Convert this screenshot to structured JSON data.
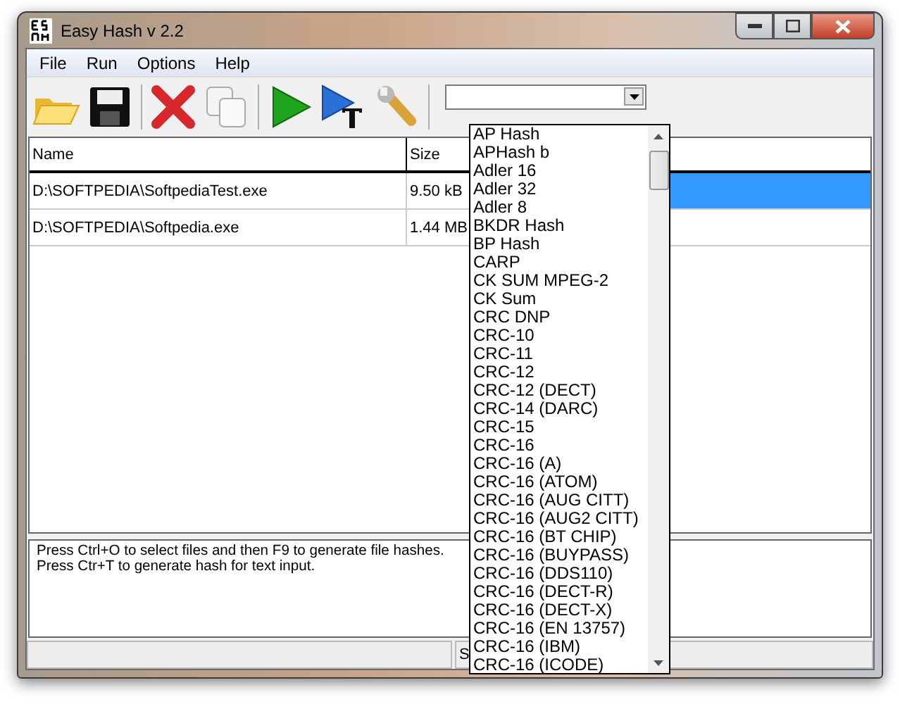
{
  "window": {
    "title": "Easy Hash v 2.2"
  },
  "menu": [
    "File",
    "Run",
    "Options",
    "Help"
  ],
  "toolbar": [
    {
      "kind": "open"
    },
    {
      "kind": "save"
    },
    {
      "kind": "sep"
    },
    {
      "kind": "delete"
    },
    {
      "kind": "copy"
    },
    {
      "kind": "sep"
    },
    {
      "kind": "run"
    },
    {
      "kind": "text"
    },
    {
      "kind": "tools"
    },
    {
      "kind": "sep"
    }
  ],
  "table": {
    "columns": [
      "Name",
      "Size"
    ],
    "rows": [
      {
        "name": "D:\\SOFTPEDIA\\SoftpediaTest.exe",
        "size": "9.50 kB",
        "selected": true
      },
      {
        "name": "D:\\SOFTPEDIA\\Softpedia.exe",
        "size": "1.44 MB",
        "selected": false
      }
    ]
  },
  "output": [
    "Press Ctrl+O to select files and then F9 to generate file hashes.",
    "Press Ctr+T to generate hash for text input."
  ],
  "status_bar": {
    "text": "S"
  },
  "hash_dropdown": {
    "expanded": true,
    "items": [
      "AP Hash",
      "APHash b",
      "Adler 16",
      "Adler 32",
      "Adler 8",
      "BKDR Hash",
      "BP Hash",
      "CARP",
      "CK SUM MPEG-2",
      "CK Sum",
      "CRC DNP",
      "CRC-10",
      "CRC-11",
      "CRC-12",
      "CRC-12 (DECT)",
      "CRC-14 (DARC)",
      "CRC-15",
      "CRC-16",
      "CRC-16 (A)",
      "CRC-16 (ATOM)",
      "CRC-16 (AUG CITT)",
      "CRC-16 (AUG2 CITT)",
      "CRC-16 (BT CHIP)",
      "CRC-16 (BUYPASS)",
      "CRC-16 (DDS110)",
      "CRC-16 (DECT-R)",
      "CRC-16 (DECT-X)",
      "CRC-16 (EN 13757)",
      "CRC-16 (IBM)",
      "CRC-16 (ICODE)"
    ]
  }
}
